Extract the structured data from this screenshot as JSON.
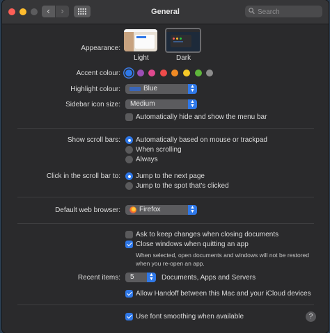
{
  "window": {
    "title": "General"
  },
  "search": {
    "placeholder": "Search"
  },
  "appearance": {
    "label": "Appearance:",
    "options": [
      "Light",
      "Dark"
    ],
    "selected": "Dark"
  },
  "accent": {
    "label": "Accent colour:",
    "colors": [
      "#2f78e8",
      "#9b4fb5",
      "#e0498f",
      "#ee4b4b",
      "#f08a24",
      "#f5c827",
      "#5fb63b",
      "#8c8c8c"
    ],
    "selected_index": 0
  },
  "highlight": {
    "label": "Highlight colour:",
    "value": "Blue",
    "swatch_color": "#3a66b8"
  },
  "sidebar_size": {
    "label": "Sidebar icon size:",
    "value": "Medium"
  },
  "menubar": {
    "label": "Automatically hide and show the menu bar",
    "checked": false
  },
  "scroll_bars": {
    "label": "Show scroll bars:",
    "options": [
      "Automatically based on mouse or trackpad",
      "When scrolling",
      "Always"
    ],
    "selected_index": 0
  },
  "click_scroll": {
    "label": "Click in the scroll bar to:",
    "options": [
      "Jump to the next page",
      "Jump to the spot that's clicked"
    ],
    "selected_index": 0
  },
  "browser": {
    "label": "Default web browser:",
    "value": "Firefox"
  },
  "ask_keep": {
    "label": "Ask to keep changes when closing documents",
    "checked": false
  },
  "close_windows": {
    "label": "Close windows when quitting an app",
    "checked": true,
    "note_line1": "When selected, open documents and windows will not be restored",
    "note_line2": "when you re-open an app."
  },
  "recent_items": {
    "label": "Recent items:",
    "value": "5",
    "suffix": "Documents, Apps and Servers"
  },
  "handoff": {
    "label": "Allow Handoff between this Mac and your iCloud devices",
    "checked": true
  },
  "font_smoothing": {
    "label": "Use font smoothing when available",
    "checked": true
  },
  "icons": {
    "back": "chevron-left",
    "forward": "chevron-right",
    "grid": "grid",
    "search": "magnifier",
    "help": "question-mark",
    "browser": "firefox"
  },
  "help_glyph": "?"
}
